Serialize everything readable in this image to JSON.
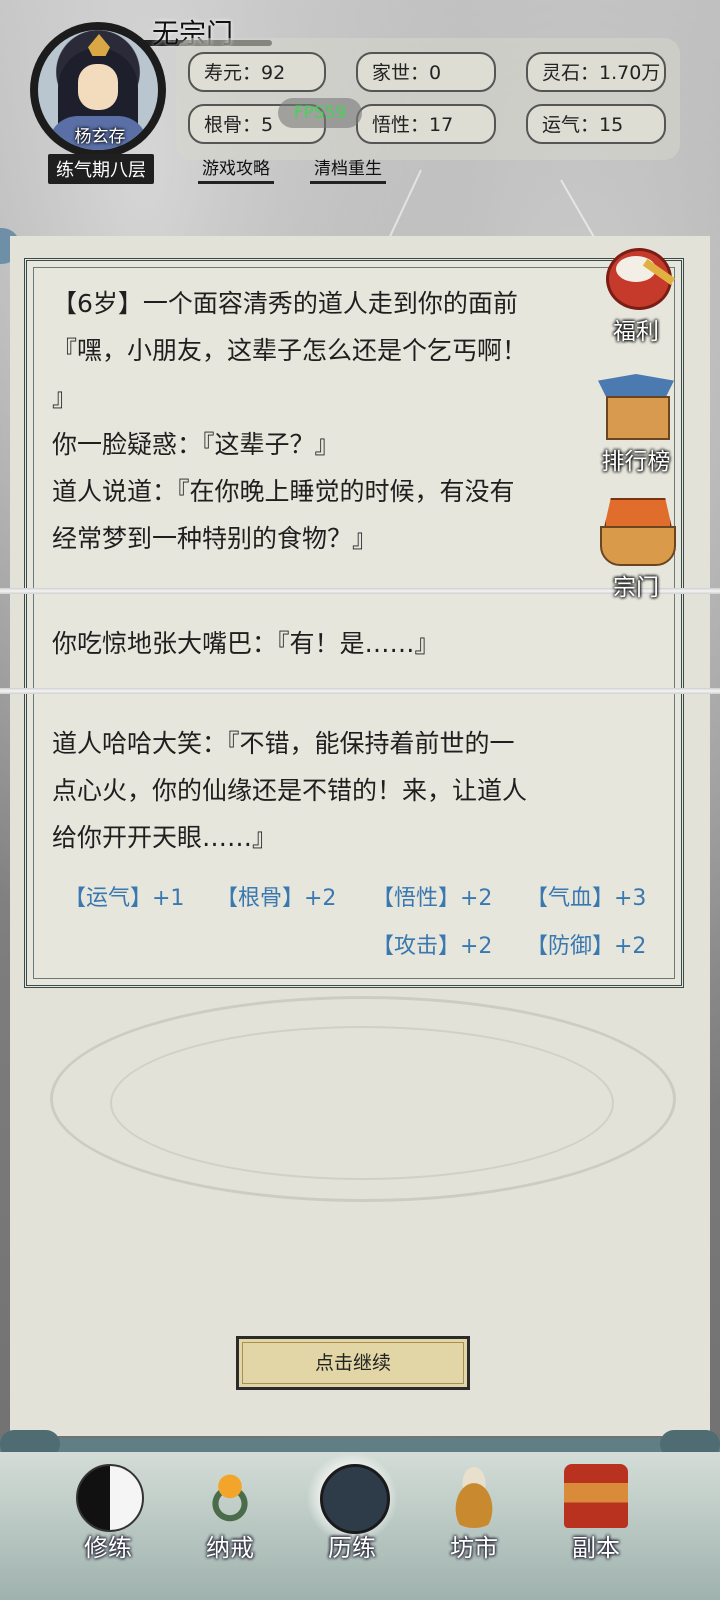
{
  "header": {
    "sect": "无宗门",
    "player_name": "杨玄存",
    "realm": "练气期八层",
    "fps": "FPS59",
    "stats": [
      {
        "label": "寿元：92"
      },
      {
        "label": "家世：0"
      },
      {
        "label": "灵石：1.70万"
      },
      {
        "label": "根骨：5"
      },
      {
        "label": "悟性：17"
      },
      {
        "label": "运气：15"
      }
    ],
    "links": {
      "guide": "游戏攻略",
      "reset": "清档重生"
    }
  },
  "story": {
    "p1": [
      "【6岁】一个面容清秀的道人走到你的面前",
      "『嘿，小朋友，这辈子怎么还是个乞丐啊！",
      "』",
      "你一脸疑惑：『这辈子？』",
      "道人说道：『在你晚上睡觉的时候，有没有",
      "经常梦到一种特别的食物？』"
    ],
    "p2": "你吃惊地张大嘴巴：『有！是……』",
    "p3": [
      "道人哈哈大笑：『不错，能保持着前世的一",
      "点心火，你的仙缘还是不错的！来，让道人",
      "给你开开天眼……』"
    ],
    "rewards_row1": [
      "【运气】+1",
      "【根骨】+2",
      "【悟性】+2",
      "【气血】+3"
    ],
    "rewards_row2": [
      "【攻击】+2",
      "【防御】+2"
    ]
  },
  "side": {
    "welfare": "福利",
    "ranking": "排行榜",
    "sect": "宗门"
  },
  "continue_label": "点击继续",
  "nav": [
    "修练",
    "纳戒",
    "历练",
    "坊市",
    "副本"
  ],
  "colors": {
    "reward": "#3a78b0",
    "fps": "#46d35a",
    "continue_bg": "#e3d6a6"
  }
}
